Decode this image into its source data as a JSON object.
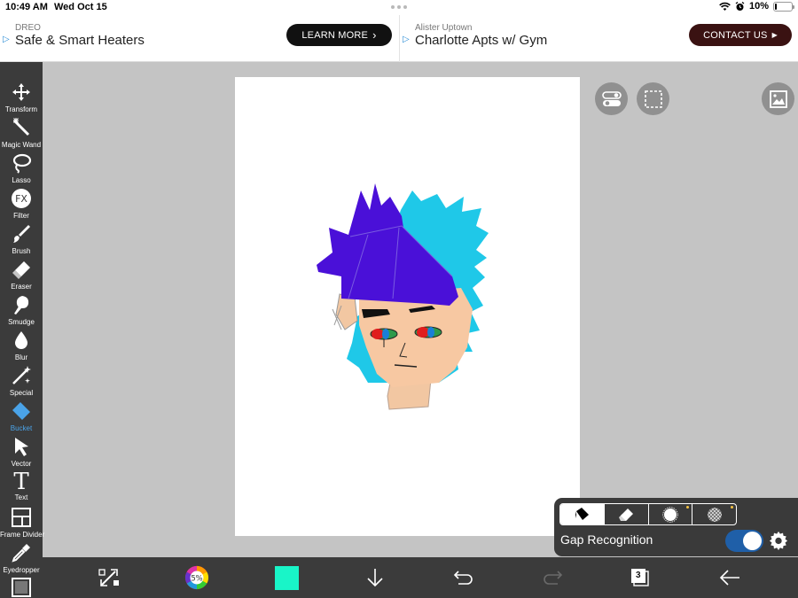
{
  "status": {
    "time": "10:49 AM",
    "date": "Wed Oct 15",
    "battery": "10%",
    "battery_level": 0.1
  },
  "ads": [
    {
      "advertiser": "DREO",
      "headline": "Safe & Smart Heaters",
      "cta": "LEARN MORE",
      "cta_color": "#111111"
    },
    {
      "advertiser": "Alister Uptown",
      "headline": "Charlotte Apts w/ Gym",
      "cta": "CONTACT US",
      "cta_color": "#3a1212"
    }
  ],
  "tools": [
    {
      "label": "Transform",
      "icon": "move-arrows-icon"
    },
    {
      "label": "Magic Wand",
      "icon": "magic-wand-icon"
    },
    {
      "label": "Lasso",
      "icon": "lasso-icon"
    },
    {
      "label": "Filter",
      "icon": "fx-icon"
    },
    {
      "label": "Brush",
      "icon": "brush-icon"
    },
    {
      "label": "Eraser",
      "icon": "eraser-icon"
    },
    {
      "label": "Smudge",
      "icon": "smudge-icon"
    },
    {
      "label": "Blur",
      "icon": "drop-icon"
    },
    {
      "label": "Special",
      "icon": "sparkle-wand-icon"
    },
    {
      "label": "Bucket",
      "icon": "bucket-icon",
      "active": true
    },
    {
      "label": "Vector",
      "icon": "cursor-arrow-icon"
    },
    {
      "label": "Text",
      "icon": "text-t-icon"
    },
    {
      "label": "Frame Divider",
      "icon": "frame-divider-icon"
    },
    {
      "label": "Eyedropper",
      "icon": "eyedropper-icon"
    }
  ],
  "filter_icon_text": "FX",
  "text_icon_glyph": "T",
  "bucket_panel": {
    "gap_label": "Gap Recognition",
    "gap_enabled": true,
    "modes": [
      "bucket-icon",
      "eraser-icon",
      "circle-icon",
      "transparency-icon"
    ],
    "active_mode": 0
  },
  "bottom": {
    "color_wheel_label": "5%",
    "current_color": "#19f5c8",
    "layer_count": "3"
  },
  "colors": {
    "accent": "#4aa3e8",
    "toolbar_bg": "#3b3b3b",
    "workspace_bg": "#c4c4c4"
  }
}
